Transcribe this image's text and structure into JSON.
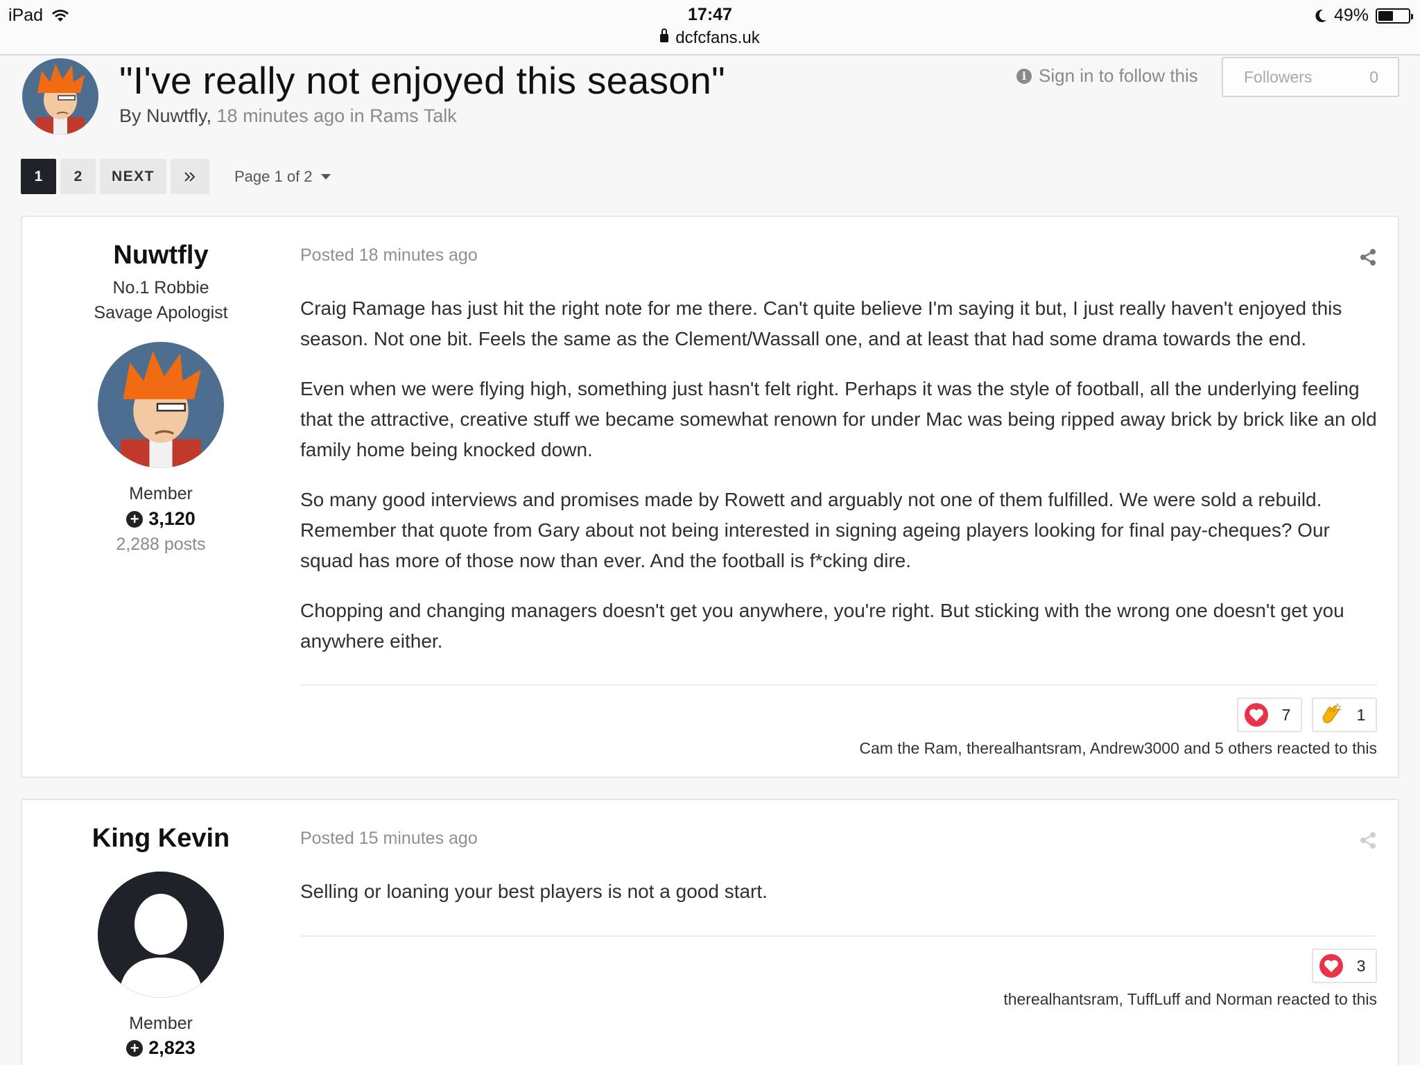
{
  "statusbar": {
    "device": "iPad",
    "time": "17:47",
    "url": "dcfcfans.uk",
    "battery": "49%",
    "battery_level": 0.49
  },
  "topic": {
    "title": "\"I've really not enjoyed this season\"",
    "by_label": "By Nuwtfly,",
    "meta_rest": " 18 minutes ago in Rams Talk",
    "follow_label": "Sign in to follow this",
    "followers_label": "Followers",
    "followers_count": "0"
  },
  "pagination": {
    "pages": [
      "1",
      "2"
    ],
    "next_label": "NEXT",
    "last_label": "»",
    "page_of_label": "Page 1 of 2"
  },
  "posts": [
    {
      "author": "Nuwtfly",
      "author_title": "No.1 Robbie Savage Apologist",
      "rank": "Member",
      "reputation": "3,120",
      "post_count": "2,288 posts",
      "date": "Posted 18 minutes ago",
      "paragraphs": [
        "Craig Ramage has just hit the right note for me there. Can't quite believe I'm saying it but, I just really haven't enjoyed this season. Not one bit. Feels the same as the Clement/Wassall one, and at least that had some drama towards the end.",
        "Even when we were flying high, something just hasn't felt right. Perhaps it was the style of football, all the underlying feeling that the attractive, creative stuff we became somewhat renown for under Mac was being ripped away brick by brick like an old family home being knocked down.",
        "So many good interviews and promises made by Rowett and arguably not one of them fulfilled. We were sold a rebuild. Remember that quote from Gary about not being interested in signing ageing players looking for final pay-cheques? Our squad has more of those now than ever. And the football is f*cking dire.",
        "Chopping and changing managers doesn't get you anywhere, you're right. But sticking with the wrong one doesn't get you anywhere either."
      ],
      "reactions": [
        {
          "icon": "heart-icon",
          "count": "7"
        },
        {
          "icon": "clapping-hands-icon",
          "count": "1"
        }
      ],
      "reacted_text": "Cam the Ram, therealhantsram, Andrew3000 and 5 others reacted to this"
    },
    {
      "author": "King Kevin",
      "rank": "Member",
      "reputation": "2,823",
      "date": "Posted 15 minutes ago",
      "paragraphs": [
        "Selling or loaning your best players is not a good start."
      ],
      "reactions": [
        {
          "icon": "heart-icon",
          "count": "3"
        }
      ],
      "reacted_text": "therealhantsram, TuffLuff and Norman reacted to this"
    }
  ],
  "colors": {
    "accent_dark": "#1f2229",
    "heart": "#e8334a",
    "muted_text": "#8a8a8a"
  }
}
